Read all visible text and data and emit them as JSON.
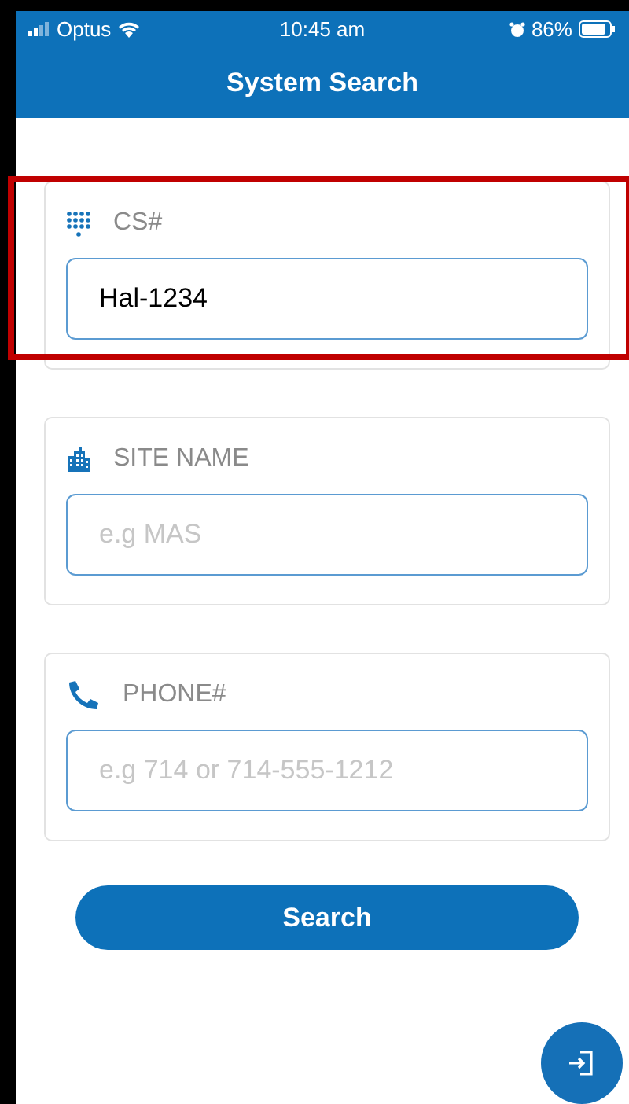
{
  "status_bar": {
    "carrier": "Optus",
    "time": "10:45 am",
    "battery": "86%"
  },
  "header": {
    "title": "System Search"
  },
  "fields": [
    {
      "kind": "keypad",
      "label": "CS#",
      "value": "Hal-1234",
      "highlighted": true
    },
    {
      "kind": "building",
      "label": "SITE NAME",
      "placeholder": "e.g MAS",
      "highlighted": false
    },
    {
      "kind": "phone",
      "label": "PHONE#",
      "placeholder": "e.g 714 or 714-555-1212",
      "highlighted": false
    }
  ],
  "search_button": "Search"
}
